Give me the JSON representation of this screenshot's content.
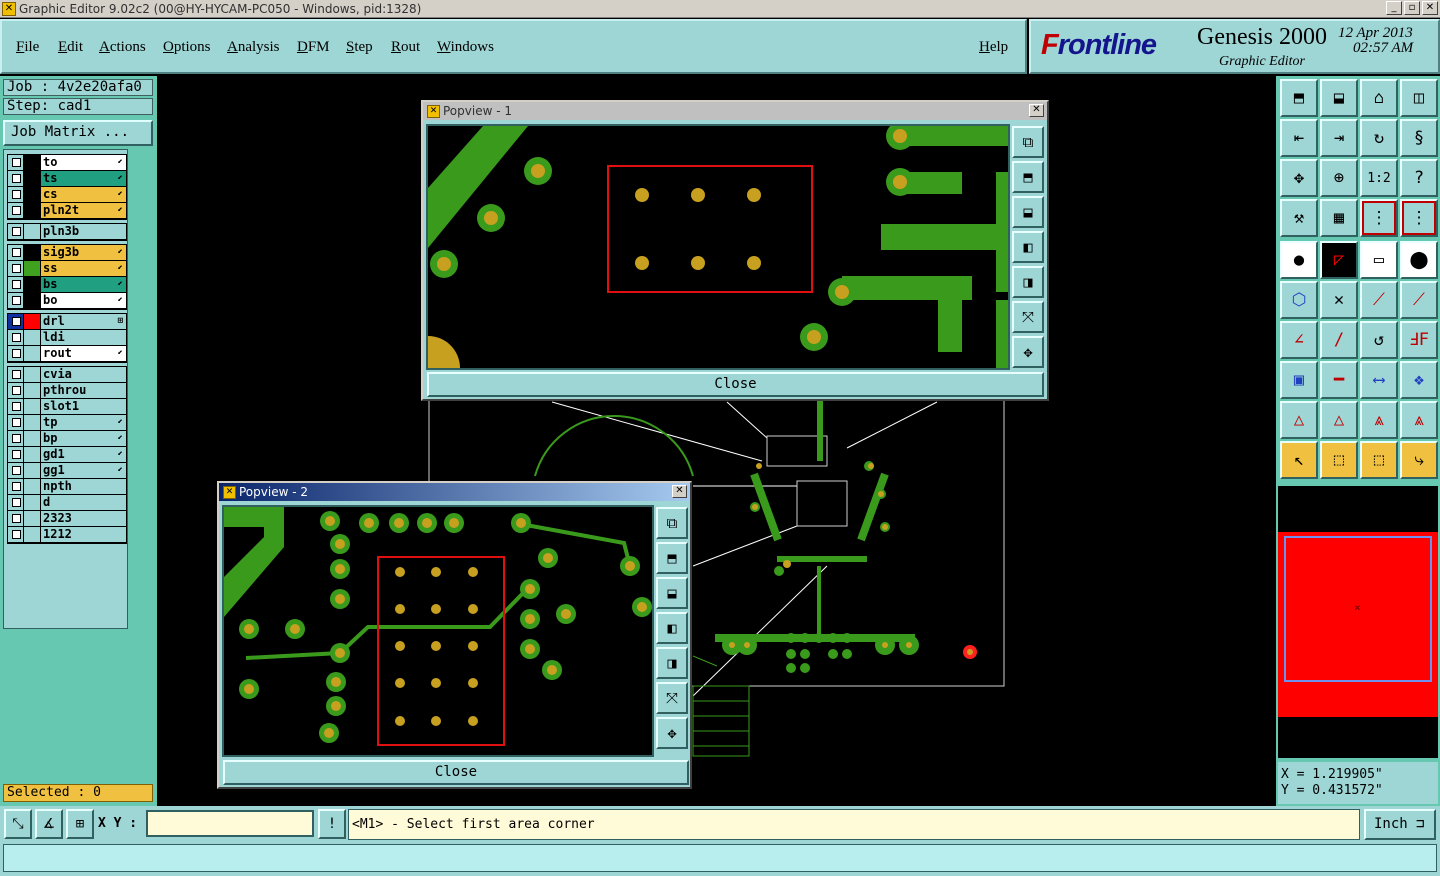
{
  "window": {
    "title": "Graphic Editor 9.02c2 (00@HY-HYCAM-PC050 - Windows, pid:1328)"
  },
  "menu": {
    "items": [
      "File",
      "Edit",
      "Actions",
      "Options",
      "Analysis",
      "DFM",
      "Step",
      "Rout",
      "Windows"
    ],
    "help": "Help"
  },
  "logo": {
    "brand_f": "F",
    "brand_rest": "rontline",
    "product": "Genesis 2000",
    "subtitle": "Graphic Editor",
    "date": "12 Apr 2013",
    "time": "02:57 AM"
  },
  "left": {
    "job": "Job : 4v2e20afa0",
    "step": "Step: cad1",
    "job_matrix": "Job Matrix ...",
    "layers": [
      {
        "name": "to",
        "color": "#ffffff",
        "swatch": "#000000",
        "arrow": true
      },
      {
        "name": "ts",
        "color": "#20a080",
        "swatch": "#000000",
        "arrow": true
      },
      {
        "name": "cs",
        "color": "#f0c040",
        "swatch": "#000000",
        "arrow": true
      },
      {
        "name": "pln2t",
        "color": "#f0c040",
        "swatch": "#000000",
        "arrow": true
      },
      {
        "name": "pln3b",
        "color": "#9ed5d5",
        "swatch": "#000000",
        "arrow": false
      },
      {
        "name": "sig3b",
        "color": "#f0c040",
        "swatch": "#000000",
        "arrow": true
      },
      {
        "name": "ss",
        "color": "#f0c040",
        "swatch": "#40a020",
        "arrow": true
      },
      {
        "name": "bs",
        "color": "#20a080",
        "swatch": "#000000",
        "arrow": true
      },
      {
        "name": "bo",
        "color": "#ffffff",
        "swatch": "#000000",
        "arrow": true
      },
      {
        "name": "drl",
        "color": "#9ed5d5",
        "swatch": "#ff0000",
        "arrow": true
      },
      {
        "name": "ldi",
        "color": "#9ed5d5",
        "swatch": "#000000",
        "arrow": false
      },
      {
        "name": "rout",
        "color": "#ffffff",
        "swatch": "#000000",
        "arrow": true
      },
      {
        "name": "cvia",
        "color": "#9ed5d5",
        "swatch": "#000000",
        "arrow": false
      },
      {
        "name": "pthrou",
        "color": "#9ed5d5",
        "swatch": "#000000",
        "arrow": false
      },
      {
        "name": "slot1",
        "color": "#9ed5d5",
        "swatch": "#000000",
        "arrow": false
      },
      {
        "name": "tp",
        "color": "#9ed5d5",
        "swatch": "#000000",
        "arrow": true
      },
      {
        "name": "bp",
        "color": "#9ed5d5",
        "swatch": "#000000",
        "arrow": true
      },
      {
        "name": "gd1",
        "color": "#9ed5d5",
        "swatch": "#000000",
        "arrow": true
      },
      {
        "name": "gg1",
        "color": "#9ed5d5",
        "swatch": "#000000",
        "arrow": true
      },
      {
        "name": "npth",
        "color": "#9ed5d5",
        "swatch": "#000000",
        "arrow": false
      },
      {
        "name": "d",
        "color": "#9ed5d5",
        "swatch": "#000000",
        "arrow": false
      },
      {
        "name": "2323",
        "color": "#9ed5d5",
        "swatch": "#000000",
        "arrow": false
      },
      {
        "name": "1212",
        "color": "#9ed5d5",
        "swatch": "#000000",
        "arrow": false
      }
    ],
    "selected": "Selected : 0"
  },
  "popup1": {
    "title": "Popview - 1",
    "close": "Close"
  },
  "popup2": {
    "title": "Popview - 2",
    "close": "Close"
  },
  "coords": {
    "x": "X = 1.219905\"",
    "y": "Y = 0.431572\""
  },
  "bottom": {
    "xy_label": "X Y :",
    "xy_value": "",
    "prompt": "<M1> - Select first area corner",
    "units": "Inch"
  },
  "colors": {
    "copper": "#3a9a1c",
    "pad": "#c8a020",
    "highlight": "#e01010"
  }
}
